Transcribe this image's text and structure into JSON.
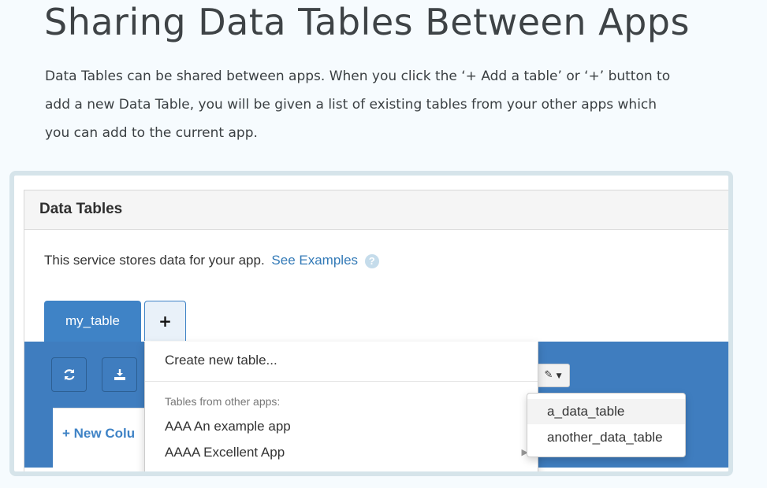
{
  "page": {
    "title": "Sharing Data Tables Between Apps",
    "intro_line1": "Data Tables can be shared between apps. When you click the ‘+ Add a table’ or ‘+’ button to",
    "intro_line2": "add a new Data Table, you will be given a list of existing tables from your other apps which",
    "intro_line3": "you can add to the current app."
  },
  "panel": {
    "heading": "Data Tables",
    "description": "This service stores data for your app.",
    "examples_link": "See Examples",
    "help_icon": "question-circle-icon"
  },
  "tabs": {
    "active_label": "my_table",
    "add_label": "+"
  },
  "toolbar": {
    "refresh_icon": "refresh-icon",
    "download_icon": "download-icon",
    "edit_icon": "pencil-icon",
    "new_column_label": "+ New Colu"
  },
  "dropdown": {
    "create_label": "Create new table...",
    "other_apps_header": "Tables from other apps:",
    "apps": [
      "AAA An example app",
      "AAAA Excellent App"
    ]
  },
  "submenu": {
    "tables": [
      "a_data_table",
      "another_data_table"
    ]
  },
  "colors": {
    "accent_blue": "#3f83c6",
    "link_blue": "#337ab7",
    "background": "#f6fbfe"
  }
}
